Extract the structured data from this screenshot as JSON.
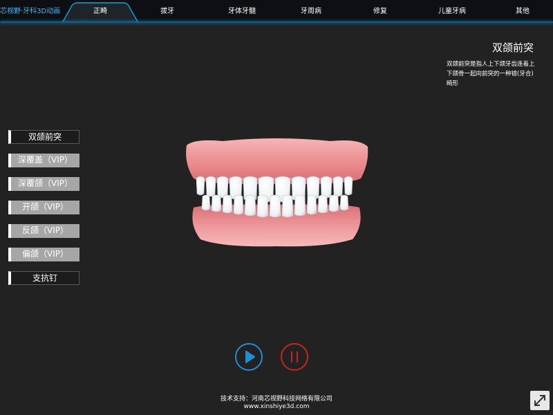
{
  "brand": {
    "title": "芯视野·牙科3D动画"
  },
  "nav": {
    "tabs": [
      {
        "label": "正畸",
        "active": true
      },
      {
        "label": "拔牙"
      },
      {
        "label": "牙体牙髓"
      },
      {
        "label": "牙周病"
      },
      {
        "label": "修复"
      },
      {
        "label": "儿童牙病"
      },
      {
        "label": "其他"
      }
    ]
  },
  "info": {
    "title": "双颌前突",
    "description": "双颌前突是指人上下颌牙齿连着上下颌骨一起向前突的一种错(牙合)畸形"
  },
  "menu": {
    "items": [
      {
        "label": "双颌前突",
        "style": "dark"
      },
      {
        "label": "深覆盖（VIP）",
        "style": "vip"
      },
      {
        "label": "深覆颌（VIP）",
        "style": "vip"
      },
      {
        "label": "开颌（VIP）",
        "style": "vip"
      },
      {
        "label": "反颌（VIP）",
        "style": "vip"
      },
      {
        "label": "偏颌（VIP）",
        "style": "vip"
      },
      {
        "label": "支抗钉",
        "style": "dark"
      }
    ]
  },
  "controls": {
    "play_icon": "play-icon",
    "pause_icon": "pause-icon",
    "play_color": "#1d8fd8",
    "pause_color": "#c7261f"
  },
  "footer": {
    "support": "技术支持：河南芯视野科技网络有限公司",
    "url": "www.xinshiye3d.com"
  },
  "colors": {
    "accent": "#38b8f2",
    "background": "#222222"
  }
}
